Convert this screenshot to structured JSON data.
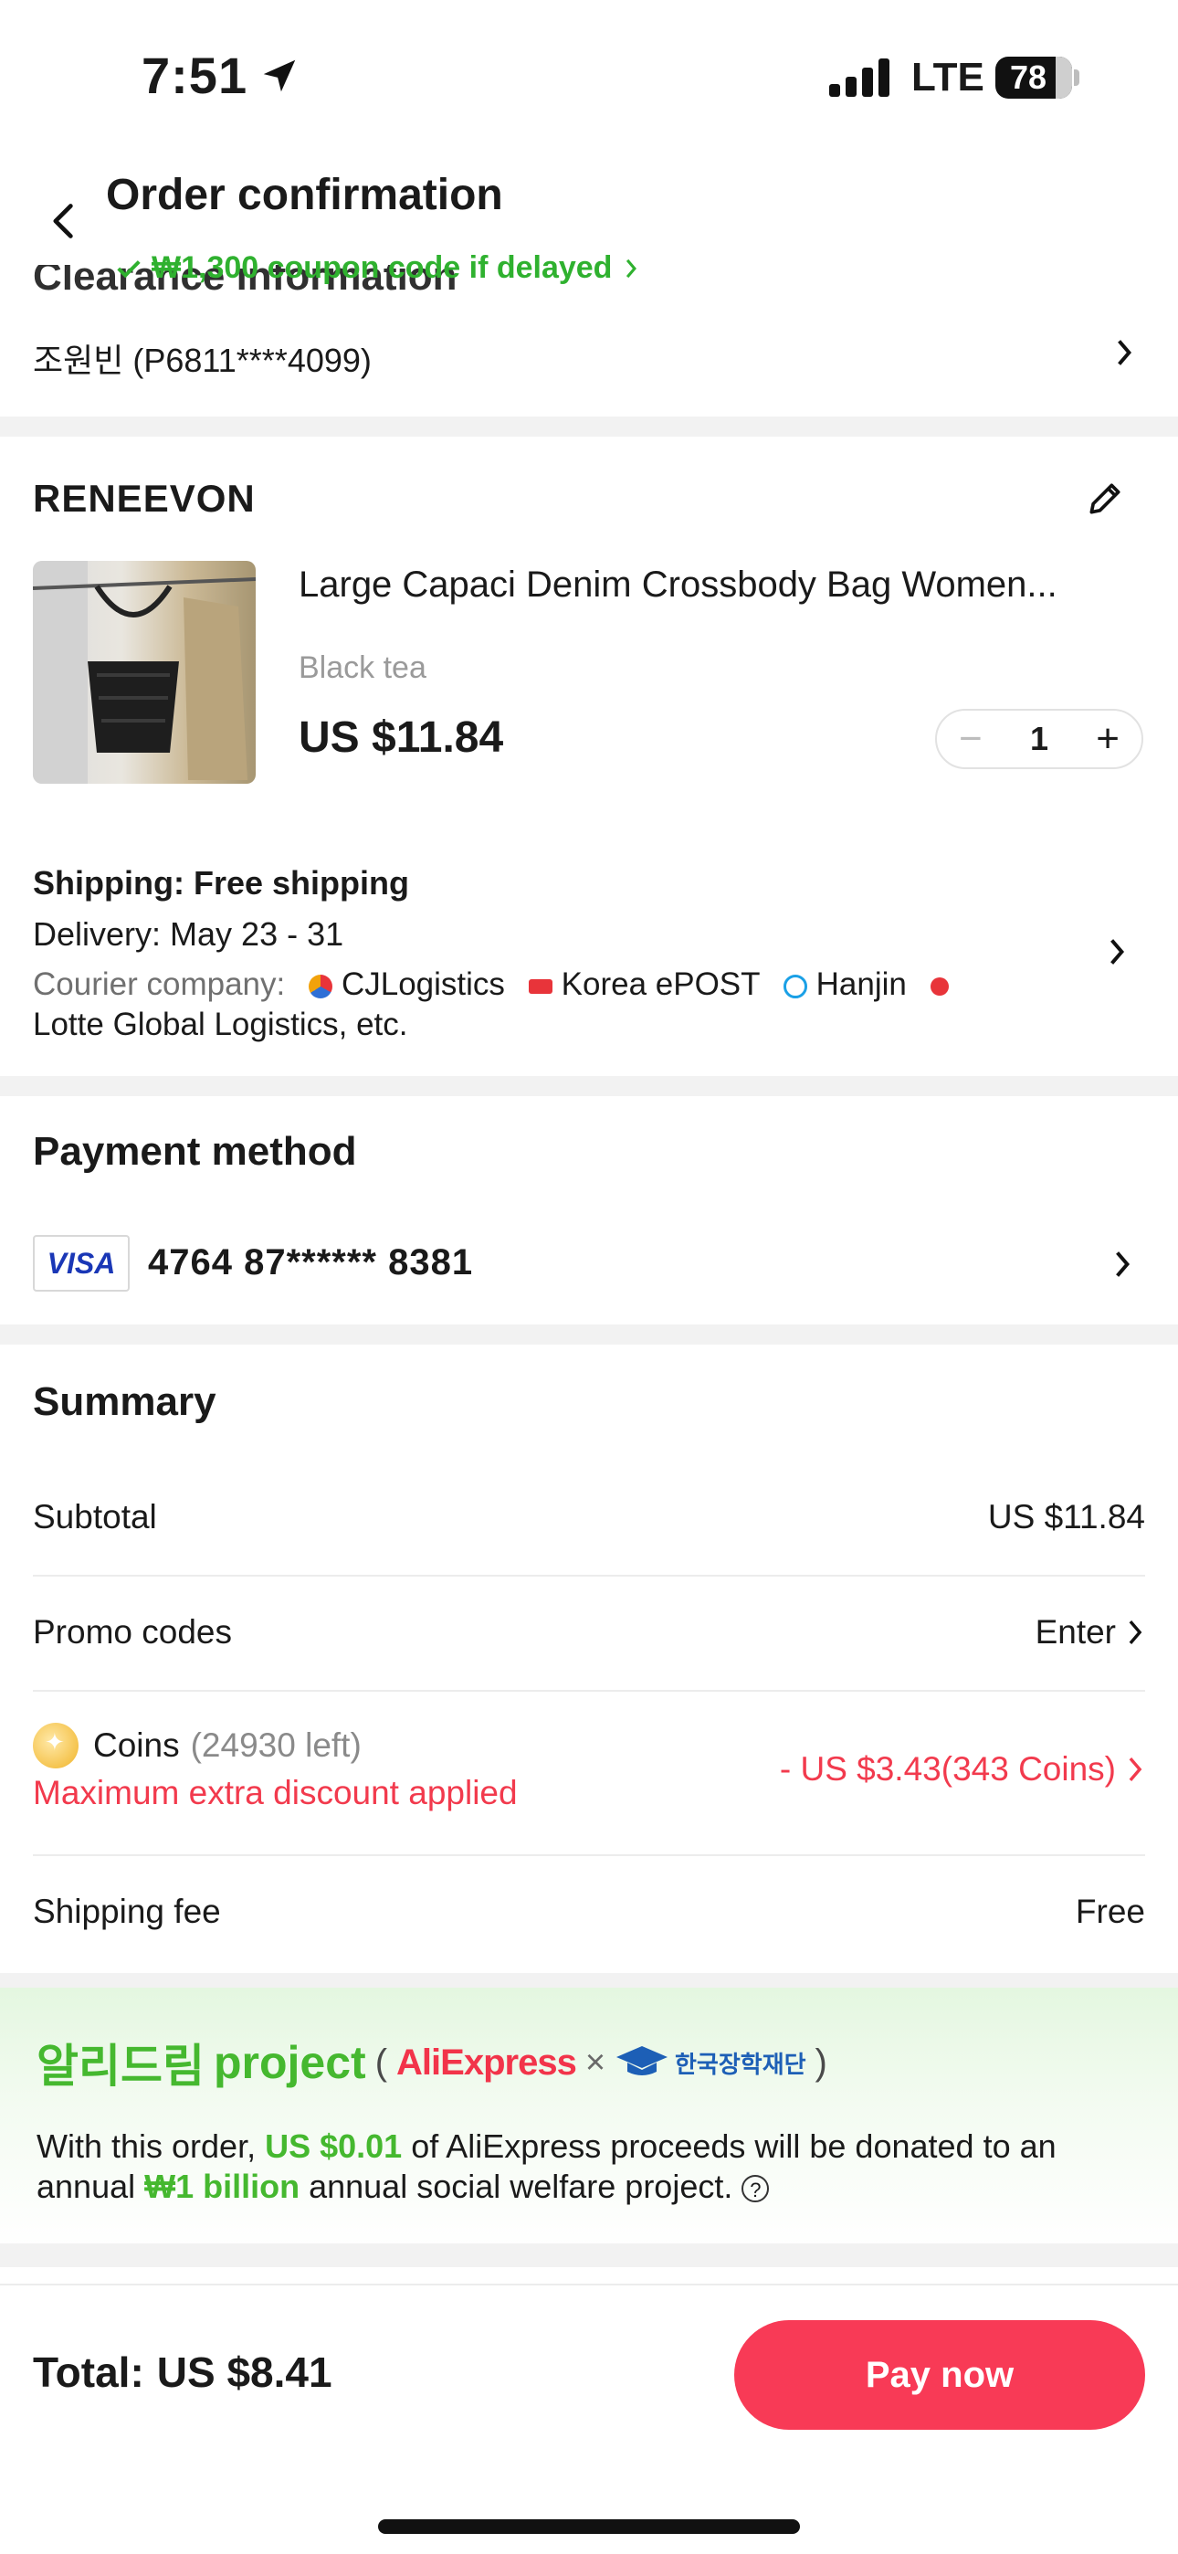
{
  "status_bar": {
    "time": "7:51",
    "network": "LTE",
    "battery": "78"
  },
  "header": {
    "title": "Order confirmation",
    "coupon_text": "₩1,300 coupon code if delayed"
  },
  "clearance": {
    "heading": "Clearance information",
    "value": "조원빈 (P6811****4099)"
  },
  "store": {
    "name": "RENEEVON",
    "product_name": "Large Capaci Denim Crossbody Bag Women...",
    "variant": "Black tea",
    "price": "US $11.84",
    "quantity": "1"
  },
  "shipping": {
    "shipping_label": "Shipping: Free shipping",
    "delivery": "Delivery: May 23 - 31",
    "courier_label": "Courier company:",
    "couriers": [
      "CJLogistics",
      "Korea ePOST",
      "Hanjin"
    ],
    "courier_tail": "Lotte Global Logistics, etc."
  },
  "payment": {
    "title": "Payment method",
    "card_brand": "VISA",
    "card_number": "4764 87****** 8381"
  },
  "summary": {
    "title": "Summary",
    "subtotal_label": "Subtotal",
    "subtotal_value": "US $11.84",
    "promo_label": "Promo codes",
    "promo_value": "Enter",
    "coins_label": "Coins",
    "coins_left": "(24930 left)",
    "coins_note": "Maximum extra discount applied",
    "coins_value": "- US $3.43(343 Coins)",
    "shipping_label": "Shipping fee",
    "shipping_value": "Free"
  },
  "dream": {
    "title_ko": "알리드림",
    "title_en": "project",
    "partner1": "AliExpress",
    "partner2": "한국장학재단",
    "text_1": "With this order, ",
    "amount": "US $0.01",
    "text_2": " of AliExpress proceeds will be donated to an annual ",
    "goal": "₩1 billion",
    "text_3": " annual social welfare project."
  },
  "footer": {
    "total_label": "Total:",
    "total_value": "US $8.41",
    "pay_label": "Pay now"
  },
  "colors": {
    "accent_red": "#f83a56",
    "discount_red": "#f23a4d",
    "success_green": "#2fb12f",
    "section_gray": "#f2f2f2"
  }
}
